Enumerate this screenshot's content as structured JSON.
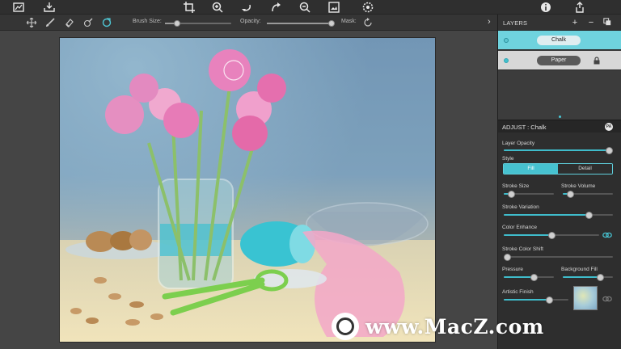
{
  "toolbar": {
    "icons": [
      "image-frame-icon",
      "save-tray-icon",
      "crop-icon",
      "zoom-in-icon",
      "undo-icon",
      "redo-icon",
      "zoom-out-icon",
      "picture-icon",
      "settings-icon",
      "info-icon",
      "share-icon"
    ]
  },
  "brushbar": {
    "tools": [
      "move-icon",
      "brush-icon",
      "eraser-icon",
      "dropper-icon",
      "clone-icon"
    ],
    "brush_size_label": "Brush Size:",
    "brush_size": 0.18,
    "opacity_label": "Opacity:",
    "opacity": 1.0,
    "mask_label": "Mask:",
    "collapse_arrow": "›"
  },
  "layers": {
    "title": "LAYERS",
    "add": "+",
    "remove": "−",
    "items": [
      {
        "name": "Chalk",
        "active": true
      },
      {
        "name": "Paper",
        "active": false,
        "locked": true
      }
    ]
  },
  "adjust": {
    "title": "ADJUST : Chalk",
    "badge": "PA",
    "layer_opacity_label": "Layer Opacity",
    "layer_opacity": 0.97,
    "style_label": "Style",
    "style_options": [
      "Fill",
      "Detail"
    ],
    "style_selected": "Fill",
    "stroke_size_label": "Stroke Size",
    "stroke_size": 0.15,
    "stroke_volume_label": "Stroke Volume",
    "stroke_volume": 0.15,
    "stroke_variation_label": "Stroke Variation",
    "stroke_variation": 0.78,
    "color_enhance_label": "Color Enhance",
    "color_enhance": 0.5,
    "stroke_color_shift_label": "Stroke Color Shift",
    "stroke_color_shift": 0.0,
    "pressure_label": "Pressure",
    "pressure": 0.6,
    "background_fill_label": "Background Fill",
    "background_fill": 0.75,
    "artistic_finish_label": "Artistic Finish",
    "artistic_finish": 0.7
  },
  "colors": {
    "accent": "#47c2d0",
    "panel_bg": "#2e2e2e",
    "active_layer": "#6fd3de"
  },
  "watermark": {
    "text": "www.MacZ.com"
  }
}
